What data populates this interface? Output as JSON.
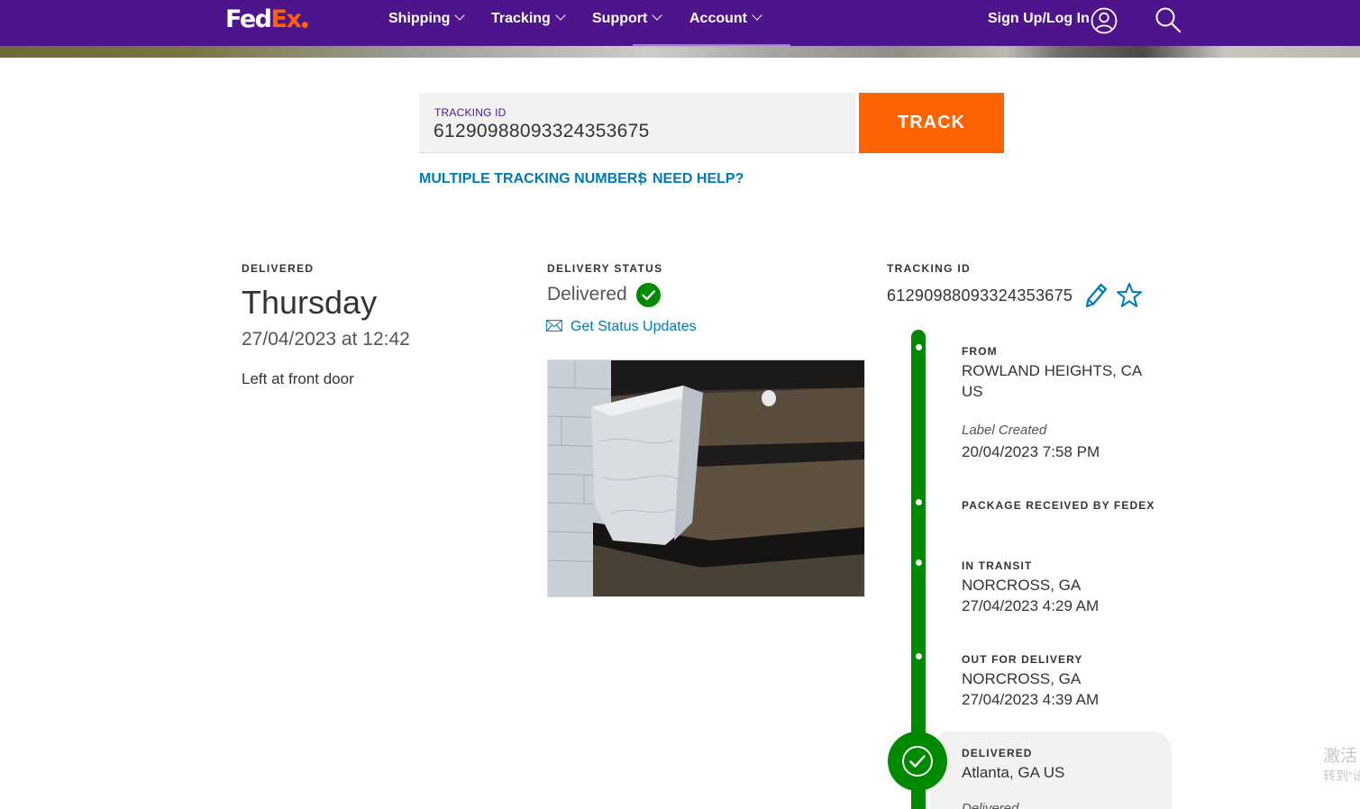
{
  "header": {
    "logo_fed": "Fed",
    "logo_ex": "Ex",
    "nav": [
      {
        "label": "Shipping"
      },
      {
        "label": "Tracking"
      },
      {
        "label": "Support"
      },
      {
        "label": "Account"
      }
    ],
    "signup_label": "Sign Up/Log In"
  },
  "tracking_form": {
    "label": "TRACKING ID",
    "value": "61290988093324353675",
    "button_label": "TRACK",
    "multiple_link": "MULTIPLE TRACKING NUMBERS",
    "separator": "|",
    "help_link": "NEED HELP?"
  },
  "delivered": {
    "label": "DELIVERED",
    "day": "Thursday",
    "datetime": "27/04/2023 at 12:42",
    "note": "Left at front door"
  },
  "delivery_status": {
    "label": "DELIVERY STATUS",
    "status": "Delivered",
    "updates_link": "Get Status Updates"
  },
  "tracking_info": {
    "label": "TRACKING ID",
    "id": "61290988093324353675"
  },
  "timeline": {
    "from": {
      "title": "FROM",
      "line1": "ROWLAND HEIGHTS, CA",
      "line2": "US",
      "event": "Label Created",
      "datetime": "20/04/2023 7:58 PM"
    },
    "received": {
      "title": "PACKAGE RECEIVED BY FEDEX"
    },
    "in_transit": {
      "title": "IN TRANSIT",
      "location": "NORCROSS, GA",
      "datetime": "27/04/2023 4:29 AM"
    },
    "out_for_delivery": {
      "title": "OUT FOR DELIVERY",
      "location": "NORCROSS, GA",
      "datetime": "27/04/2023 4:39 AM"
    },
    "delivered": {
      "title": "DELIVERED",
      "location": "Atlanta, GA US",
      "status_partial": "Delivered"
    }
  },
  "watermark": {
    "line1": "激活",
    "line2": "转到“设"
  },
  "colors": {
    "brand_purple": "#4d148c",
    "brand_orange": "#ff6200",
    "link_blue": "#007ab7",
    "success_green": "#008a00"
  },
  "icons": [
    "chevron-down-icon",
    "user-icon",
    "search-icon",
    "check-circle-icon",
    "mail-icon",
    "edit-pencil-icon",
    "star-icon"
  ]
}
